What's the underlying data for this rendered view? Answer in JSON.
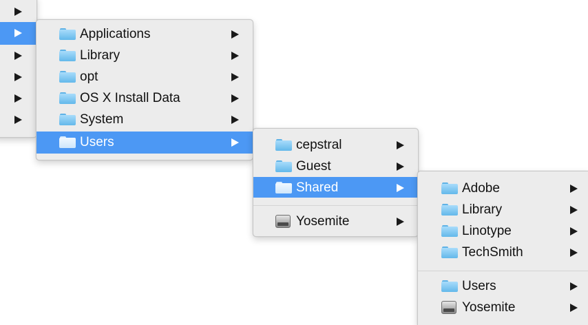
{
  "menu0": {
    "selected_index": 1,
    "item_count": 6
  },
  "menu1": {
    "items": [
      {
        "label": "Applications",
        "icon": "folder-icon"
      },
      {
        "label": "Library",
        "icon": "folder-icon"
      },
      {
        "label": "opt",
        "icon": "folder-icon"
      },
      {
        "label": "OS X Install Data",
        "icon": "folder-icon"
      },
      {
        "label": "System",
        "icon": "folder-icon"
      },
      {
        "label": "Users",
        "icon": "folder-icon",
        "selected": true
      }
    ]
  },
  "menu2": {
    "items": [
      {
        "label": "cepstral",
        "icon": "folder-icon"
      },
      {
        "label": "Guest",
        "icon": "folder-icon"
      },
      {
        "label": "Shared",
        "icon": "folder-icon",
        "selected": true
      }
    ],
    "volume": {
      "label": "Yosemite",
      "icon": "hard-disk-icon"
    }
  },
  "menu3": {
    "items": [
      {
        "label": "Adobe",
        "icon": "folder-icon"
      },
      {
        "label": "Library",
        "icon": "folder-icon"
      },
      {
        "label": "Linotype",
        "icon": "folder-icon"
      },
      {
        "label": "TechSmith",
        "icon": "folder-icon"
      }
    ],
    "extra": [
      {
        "label": "Users",
        "icon": "folder-icon"
      },
      {
        "label": "Yosemite",
        "icon": "hard-disk-icon"
      }
    ]
  },
  "colors": {
    "menu_background": "#ececec",
    "selection": "#4c98f4",
    "folder": "#63b8ea"
  }
}
